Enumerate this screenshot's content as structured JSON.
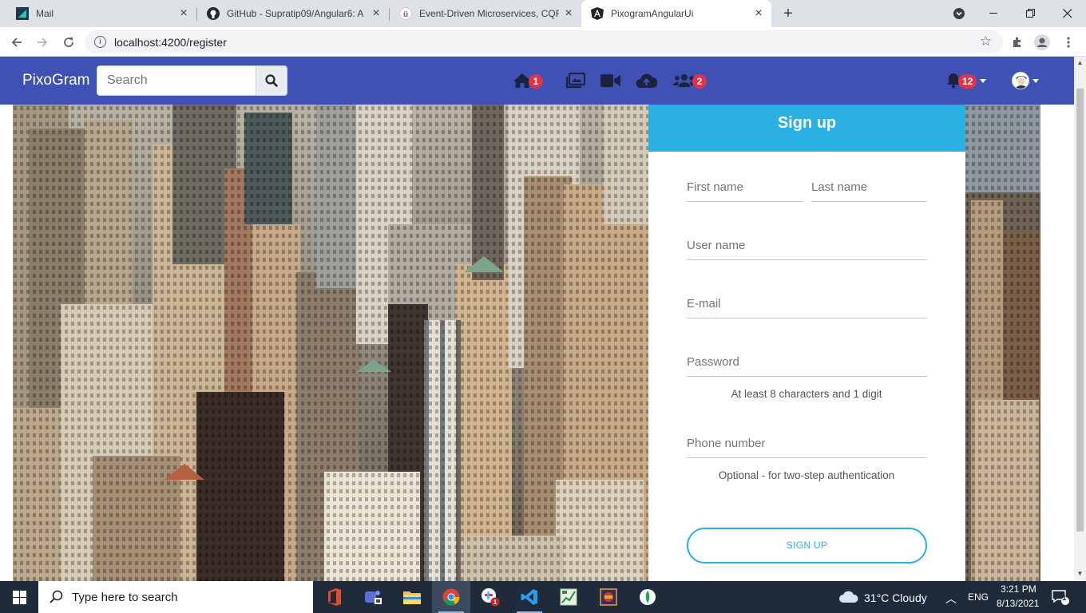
{
  "browser": {
    "tabs": [
      {
        "title": "Mail",
        "icon": "mail-app-icon"
      },
      {
        "title": "GitHub - Supratip09/Angular6: A",
        "icon": "github-icon"
      },
      {
        "title": "Event-Driven Microservices, CQR",
        "icon": "udemy-icon"
      },
      {
        "title": "PixogramAngularUi",
        "icon": "angular-icon",
        "active": true
      }
    ],
    "url": "localhost:4200/register"
  },
  "navbar": {
    "brand": "PixoGram",
    "search_placeholder": "Search",
    "home_badge": "1",
    "friends_badge": "2",
    "notifications_badge": "12"
  },
  "signup": {
    "header": "Sign up",
    "first_name_placeholder": "First name",
    "last_name_placeholder": "Last name",
    "username_placeholder": "User name",
    "email_placeholder": "E-mail",
    "password_placeholder": "Password",
    "password_hint": "At least 8 characters and 1 digit",
    "phone_placeholder": "Phone number",
    "phone_hint": "Optional - for two-step authentication",
    "button": "SIGN UP"
  },
  "taskbar": {
    "search_placeholder": "Type here to search",
    "weather": "31°C  Cloudy",
    "language": "ENG",
    "time": "3:21 PM",
    "date": "8/13/2021",
    "notification_count": "1"
  },
  "colors": {
    "navbar": "#3f51b5",
    "accent": "#2bb0e3",
    "badge": "#dc3545"
  }
}
